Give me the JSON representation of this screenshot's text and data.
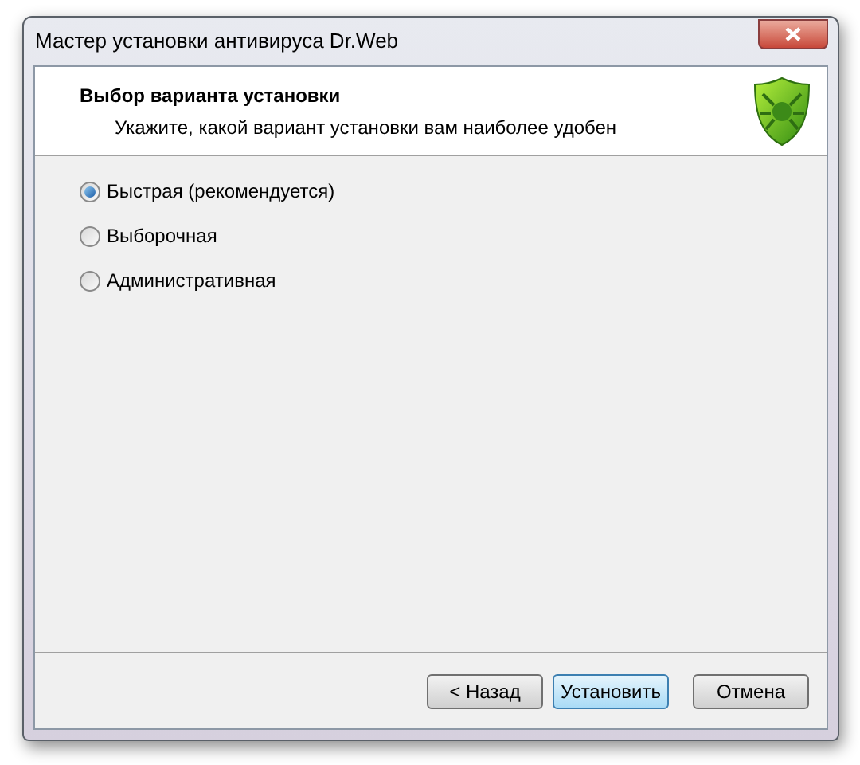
{
  "window": {
    "title": "Мастер установки антивируса Dr.Web"
  },
  "header": {
    "title": "Выбор варианта установки",
    "subtitle": "Укажите, какой вариант установки вам наиболее удобен"
  },
  "options": [
    {
      "label": "Быстрая (рекомендуется)",
      "selected": true
    },
    {
      "label": "Выборочная",
      "selected": false
    },
    {
      "label": "Административная",
      "selected": false
    }
  ],
  "buttons": [
    {
      "label": "< Назад",
      "focused": false
    },
    {
      "label": "Установить",
      "focused": true
    },
    {
      "label": "Отмена",
      "focused": false
    }
  ]
}
